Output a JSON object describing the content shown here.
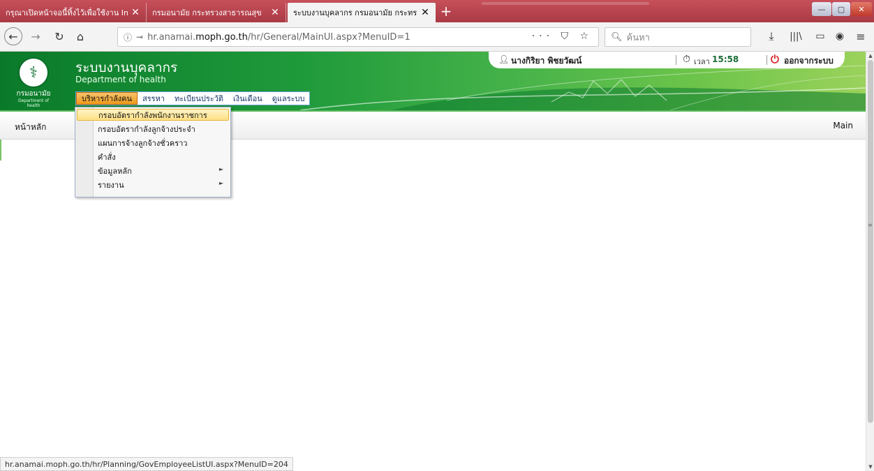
{
  "browser": {
    "tabs": [
      {
        "title": "กรุณาเปิดหน้าจอนี้ทิ้งไว้เพื่อใช้งาน Inte",
        "close": "✕"
      },
      {
        "title": "กรมอนามัย กระทรวงสาธารณสุข",
        "close": "✕"
      },
      {
        "title": "ระบบงานบุคลากร กรมอนามัย กระทรวง",
        "close": "✕"
      }
    ],
    "new_tab": "+",
    "window_controls": {
      "minimize": "—",
      "maximize": "▢",
      "close": "✕"
    },
    "address": {
      "host_prefix": "hr.anamai.",
      "host_domain": "moph.go.th",
      "path": "/hr/General/MainUI.aspx?MenuID=1"
    },
    "page_actions": "··· ⛉ ☆",
    "search_placeholder": "ค้นหา",
    "icons": [
      "back-icon",
      "forward-icon",
      "reload-icon",
      "home-icon",
      "downloads-icon",
      "library-icon",
      "sidebar-icon",
      "account-icon",
      "menu-icon"
    ],
    "status_url": "hr.anamai.moph.go.th/hr/Planning/GovEmployeeListUI.aspx?MenuID=204"
  },
  "header": {
    "logo_text": "กรมอนามัย",
    "logo_sub": "Department of health",
    "system_title": "ระบบงานบุคลากร",
    "system_subtitle": "Department of health",
    "user_name": "นางกิริยา พิชยวัฒน์",
    "time_label": "เวลา",
    "time_value": "15:58",
    "logout_label": "ออกจากระบบ"
  },
  "menu": [
    {
      "label": "บริหารกำลังคน",
      "active": true
    },
    {
      "label": "สรรหา",
      "active": false
    },
    {
      "label": "ทะเบียนประวัติ",
      "active": false
    },
    {
      "label": "เงินเดือน",
      "active": false
    },
    {
      "label": "ดูแลระบบ",
      "active": false
    }
  ],
  "dropdown": [
    {
      "label": "กรอบอัตรากำลังพนักงานราชการ",
      "highlighted": true,
      "submenu": false
    },
    {
      "label": "กรอบอัตรากำลังลูกจ้างประจำ",
      "highlighted": false,
      "submenu": false
    },
    {
      "label": "แผนการจ้างลูกจ้างชั่วคราว",
      "highlighted": false,
      "submenu": false
    },
    {
      "label": "คำสั่ง",
      "highlighted": false,
      "submenu": false
    },
    {
      "label": "ข้อมูลหลัก",
      "highlighted": false,
      "submenu": true
    },
    {
      "label": "รายงาน",
      "highlighted": false,
      "submenu": true
    }
  ],
  "breadcrumb": {
    "left": "หน้าหลัก",
    "right": "Main"
  },
  "colors": {
    "header_green": "#1f9a3b",
    "tab_bar": "#b8434d",
    "menu_active": "#ef9a1e",
    "logout_red": "#d92121"
  }
}
